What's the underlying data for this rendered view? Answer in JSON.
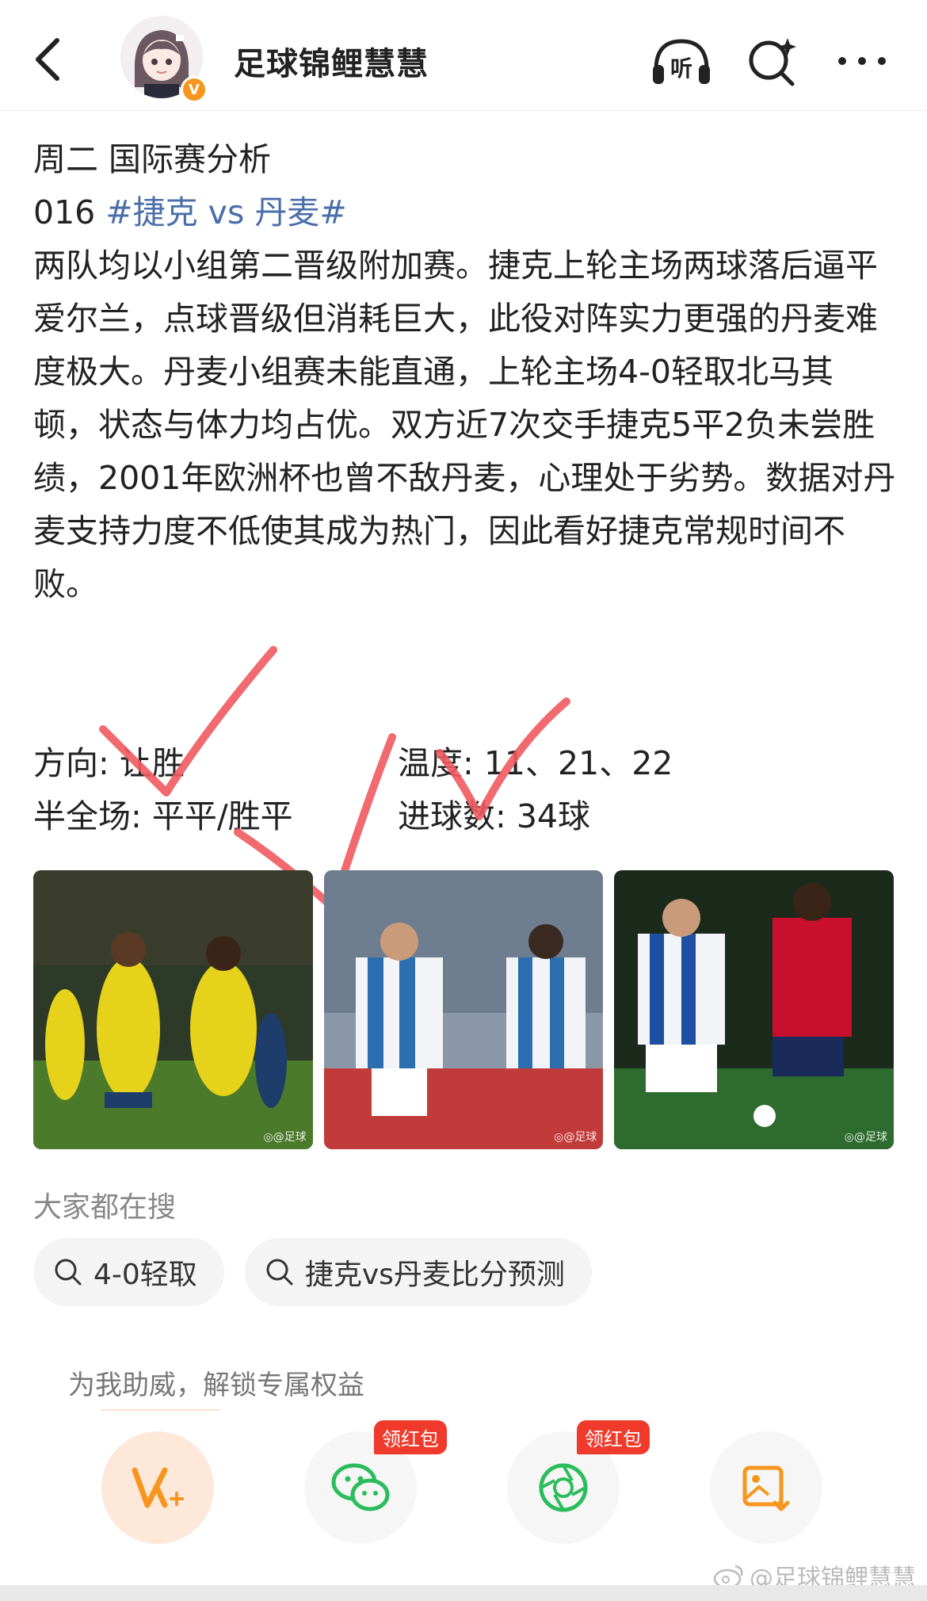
{
  "header": {
    "username": "足球锦鲤慧慧",
    "listen_label": "听"
  },
  "post": {
    "title": "周二 国际赛分析",
    "match_prefix": "016 ",
    "match_tag": "#捷克 vs 丹麦#",
    "body": "两队均以小组第二晋级附加赛。捷克上轮主场两球落后逼平爱尔兰，点球晋级但消耗巨大，此役对阵实力更强的丹麦难度极大。丹麦小组赛未能直通，上轮主场4-0轻取北马其顿，状态与体力均占优。双方近7次交手捷克5平2负未尝胜绩，2001年欧洲杯也曾不敌丹麦，心理处于劣势。数据对丹麦支持力度不低使其成为热门，因此看好捷克常规时间不败。",
    "direction": "方向: 让胜",
    "temperature": "温度: 11、21、22",
    "half_full": "半全场: 平平/胜平",
    "goals": "进球数: 34球"
  },
  "images": [
    {
      "name": "yellow-team-celebration",
      "colors": [
        "#3f6b2a",
        "#e6d21a",
        "#1f3d6a"
      ],
      "watermark": "◎@足球"
    },
    {
      "name": "blue-white-team-celebration",
      "colors": [
        "#2b6fb0",
        "#f2f4f7",
        "#b83a3a"
      ],
      "watermark": "◎@足球"
    },
    {
      "name": "blue-vs-red-players",
      "colors": [
        "#1b5e20",
        "#1f4fa3",
        "#c8102e"
      ],
      "watermark": "◎@足球"
    }
  ],
  "search": {
    "title": "大家都在搜",
    "chips": [
      "4-0轻取",
      "捷克vs丹麦比分预测"
    ]
  },
  "support": {
    "text": "为我助威，解锁专属权益",
    "badge": "领红包"
  },
  "watermark": "@足球锦鲤慧慧",
  "colors": {
    "tag": "#4a6ea9",
    "check": "#f05a5f",
    "orange": "#f7961f",
    "badge": "#f03a2b",
    "wechat": "#2bbd5b"
  }
}
